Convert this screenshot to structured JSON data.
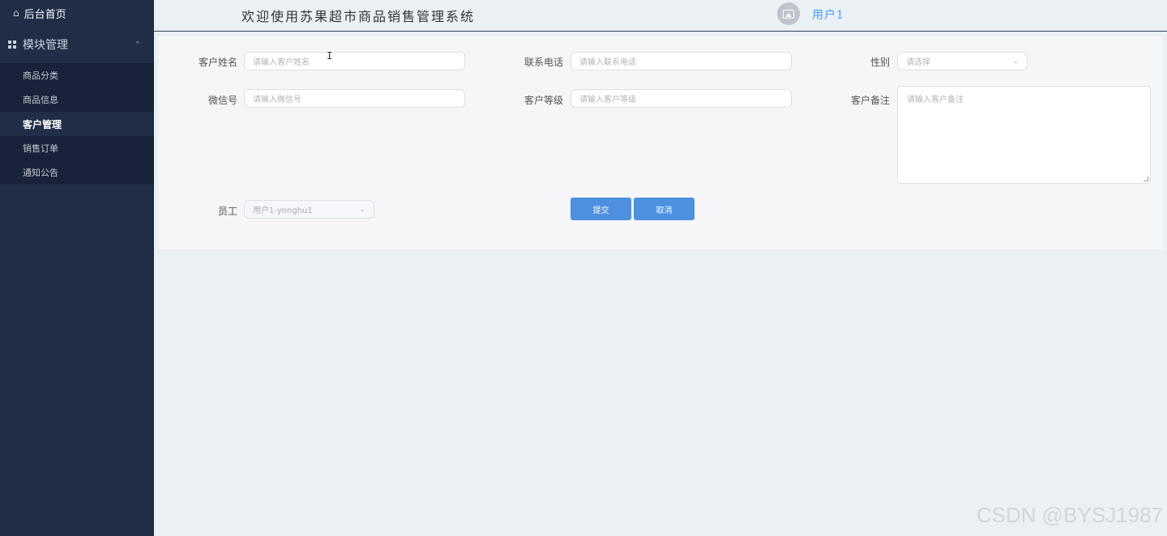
{
  "sidebar": {
    "home_label": "后台首页",
    "module_label": "模块管理",
    "items": [
      {
        "label": "商品分类"
      },
      {
        "label": "商品信息"
      },
      {
        "label": "客户管理"
      },
      {
        "label": "销售订单"
      },
      {
        "label": "通知公告"
      }
    ],
    "active_index": 2
  },
  "header": {
    "title": "欢迎使用苏果超市商品销售管理系统",
    "username": "用户1"
  },
  "form": {
    "name_label": "客户姓名",
    "name_placeholder": "请输入客户姓名",
    "phone_label": "联系电话",
    "phone_placeholder": "请输入联系电话",
    "gender_label": "性别",
    "gender_placeholder": "请选择",
    "wechat_label": "微信号",
    "wechat_placeholder": "请输入微信号",
    "level_label": "客户等级",
    "level_placeholder": "请输入客户等级",
    "remark_label": "客户备注",
    "remark_placeholder": "请输入客户备注",
    "staff_label": "员工",
    "staff_value": "用户1-yonghu1",
    "submit_label": "提交",
    "cancel_label": "取消"
  },
  "watermark": "CSDN @BYSJ1987",
  "colors": {
    "sidebar_bg": "#1f2d47",
    "primary_button": "#4d90e0",
    "username": "#409eff"
  }
}
